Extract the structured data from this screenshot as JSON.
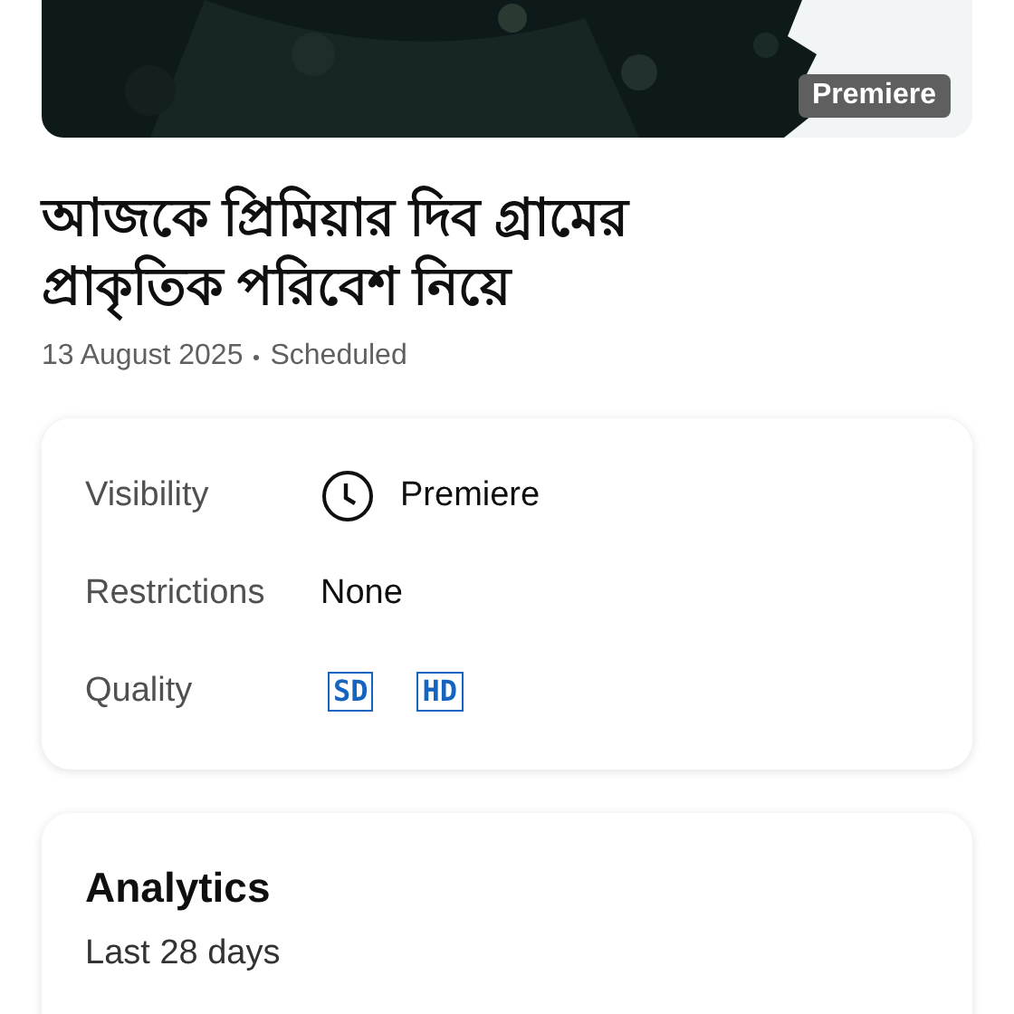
{
  "thumbnail": {
    "kind": "picture",
    "badge": "Premiere"
  },
  "title": "আজকে প্রিমিয়ার দিব গ্রামের প্রাকৃতিক পরিবেশ নিয়ে",
  "date": "13 August 2025",
  "status": "Scheduled",
  "details": [
    {
      "label": "Visibility",
      "kind": "icon",
      "value": "Premiere"
    },
    {
      "label": "Restrictions",
      "kind": "text",
      "value": "None"
    },
    {
      "label": "Quality",
      "kind": "badges",
      "badges": [
        "SD",
        "HD"
      ]
    }
  ],
  "analytics": {
    "title": "Analytics",
    "period": "Last 28 days"
  }
}
